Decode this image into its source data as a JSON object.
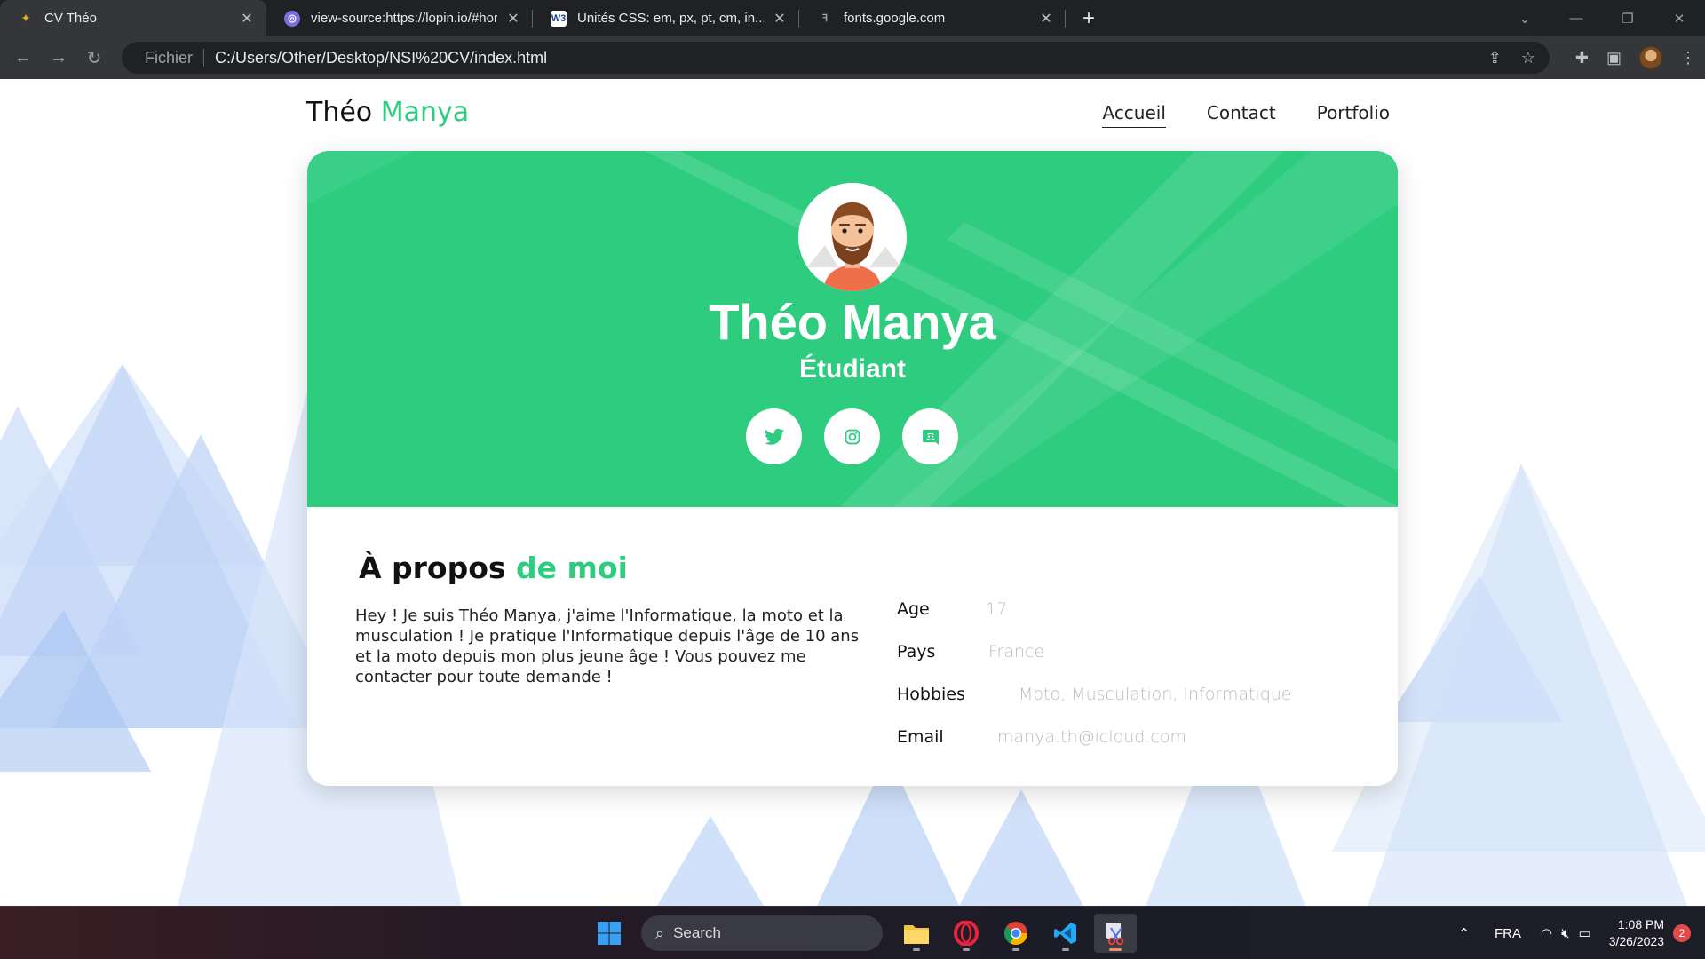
{
  "browser": {
    "tabs": [
      {
        "title": "CV Théo",
        "favicon": "cv-icon",
        "active": true
      },
      {
        "title": "view-source:https://lopin.io/#hor",
        "favicon": "lopin-icon",
        "active": false
      },
      {
        "title": "Unités CSS: em, px, pt, cm, in...",
        "favicon": "w3-icon",
        "active": false
      },
      {
        "title": "fonts.google.com",
        "favicon": "google-fonts-icon",
        "active": false
      }
    ],
    "address_prefix": "Fichier",
    "url": "C:/Users/Other/Desktop/NSI%20CV/index.html"
  },
  "site": {
    "brand_first": "Théo",
    "brand_last": "Manya",
    "nav": [
      "Accueil",
      "Contact",
      "Portfolio"
    ],
    "nav_active": "Accueil"
  },
  "hero": {
    "name": "Théo Manya",
    "role": "Étudiant",
    "socials": [
      "twitter-icon",
      "instagram-icon",
      "discord-icon"
    ]
  },
  "about": {
    "title_a": "À propos",
    "title_b": "de moi",
    "text": "Hey ! Je suis Théo Manya, j'aime l'Informatique, la moto et la musculation ! Je pratique l'Informatique depuis l'âge de 10 ans et la moto depuis mon plus jeune âge ! Vous pouvez me contacter pour toute demande !",
    "info": [
      {
        "label": "Age",
        "value": "17"
      },
      {
        "label": "Pays",
        "value": "France"
      },
      {
        "label": "Hobbies",
        "value": "Moto, Musculation, Informatique"
      },
      {
        "label": "Email",
        "value": "manya.th@icloud.com"
      }
    ]
  },
  "taskbar": {
    "search_placeholder": "Search",
    "language": "FRA",
    "time": "1:08 PM",
    "date": "3/26/2023",
    "notifications": "2"
  },
  "colors": {
    "accent": "#2ecc7f",
    "chrome_dark": "#202124",
    "chrome_toolbar": "#35363a"
  }
}
